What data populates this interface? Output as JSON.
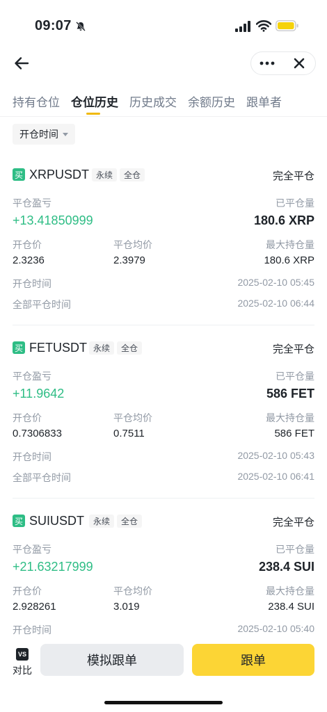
{
  "status": {
    "time": "09:07"
  },
  "tabs": [
    "持有仓位",
    "仓位历史",
    "历史成交",
    "余额历史",
    "跟单者"
  ],
  "filter": {
    "label": "开仓时间"
  },
  "labels": {
    "pnl": "平仓盈亏",
    "closed_qty": "已平仓量",
    "entry_price": "开仓价",
    "avg_close_price": "平仓均价",
    "max_hold": "最大持仓量",
    "open_time": "开仓时间",
    "full_close_time": "全部平仓时间",
    "buy_badge": "买"
  },
  "positions": [
    {
      "symbol": "XRPUSDT",
      "tag_perp": "永续",
      "tag_margin": "全仓",
      "status": "完全平仓",
      "pnl": "+13.41850999",
      "closed_qty": "180.6 XRP",
      "entry_price": "2.3236",
      "avg_close_price": "2.3979",
      "max_hold": "180.6 XRP",
      "open_time": "2025-02-10 05:45",
      "close_time": "2025-02-10 06:44"
    },
    {
      "symbol": "FETUSDT",
      "tag_perp": "永续",
      "tag_margin": "全仓",
      "status": "完全平仓",
      "pnl": "+11.9642",
      "closed_qty": "586 FET",
      "entry_price": "0.7306833",
      "avg_close_price": "0.7511",
      "max_hold": "586 FET",
      "open_time": "2025-02-10 05:43",
      "close_time": "2025-02-10 06:41"
    },
    {
      "symbol": "SUIUSDT",
      "tag_perp": "永续",
      "tag_margin": "全仓",
      "status": "完全平仓",
      "pnl": "+21.63217999",
      "closed_qty": "238.4 SUI",
      "entry_price": "2.928261",
      "avg_close_price": "3.019",
      "max_hold": "238.4 SUI",
      "open_time": "2025-02-10 05:40",
      "close_time": ""
    }
  ],
  "bottom": {
    "compare_icon": "VS",
    "compare": "对比",
    "simulate": "模拟跟单",
    "follow": "跟单"
  },
  "colors": {
    "accent": "#fcd535",
    "profit": "#2ebd85",
    "indicator": "#f0b90b"
  }
}
